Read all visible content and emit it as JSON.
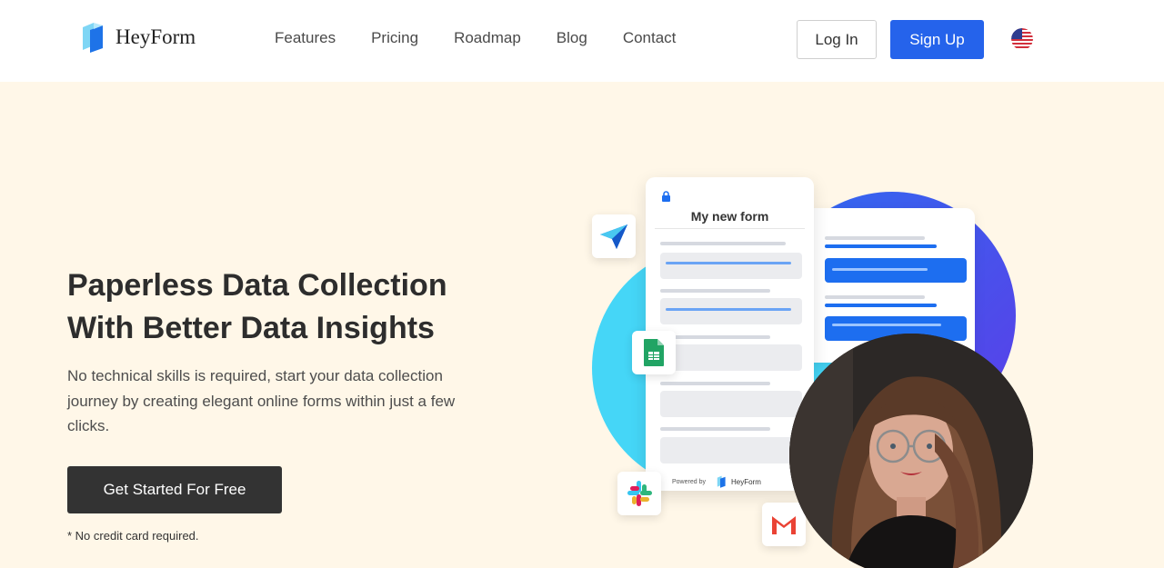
{
  "brand": {
    "name": "HeyForm",
    "color": "#2563eb"
  },
  "nav": {
    "links": [
      "Features",
      "Pricing",
      "Roadmap",
      "Blog",
      "Contact"
    ],
    "login_label": "Log In",
    "signup_label": "Sign Up",
    "language_icon": "us-flag-icon"
  },
  "hero": {
    "title_line1": "Paperless Data Collection",
    "title_line2": "With Better Data Insights",
    "subtitle": "No technical skills is required, start your data collection journey by creating elegant online forms within just a few clicks.",
    "cta_label": "Get Started For Free",
    "note": "* No credit card required."
  },
  "illustration": {
    "form_title": "My new form",
    "powered_by": "Powered by",
    "powered_brand": "HeyForm",
    "integration_icons": [
      "paper-plane-icon",
      "google-sheets-icon",
      "slack-icon",
      "gmail-icon"
    ],
    "colors": {
      "background": "#fff7e8",
      "cyan_blob": "#45d6f7",
      "blue_blob": "#3d5cef",
      "dark_button": "#333333"
    }
  }
}
